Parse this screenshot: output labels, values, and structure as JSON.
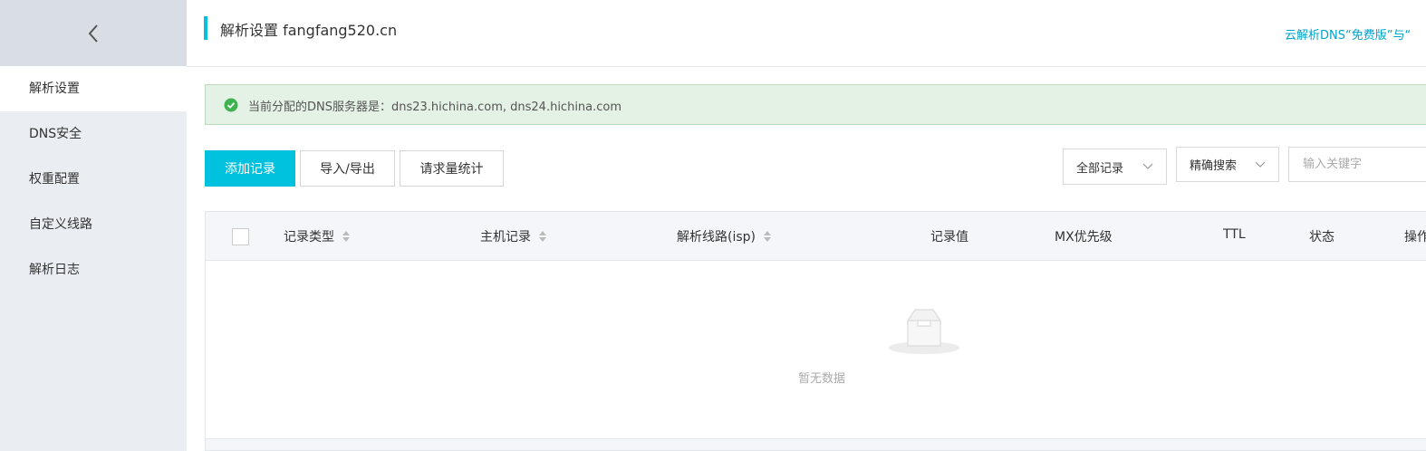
{
  "sidebar": {
    "back_icon": "chevron-left-icon",
    "items": [
      {
        "label": "解析设置",
        "active": true
      },
      {
        "label": "DNS安全",
        "active": false
      },
      {
        "label": "权重配置",
        "active": false
      },
      {
        "label": "自定义线路",
        "active": false
      },
      {
        "label": "解析日志",
        "active": false
      }
    ]
  },
  "header": {
    "title": "解析设置 fangfang520.cn",
    "link_text": "云解析DNS“免费版”与“"
  },
  "notice": {
    "icon": "check-circle-icon",
    "text": "当前分配的DNS服务器是：dns23.hichina.com, dns24.hichina.com"
  },
  "toolbar": {
    "add_label": "添加记录",
    "import_export_label": "导入/导出",
    "stats_label": "请求量统计",
    "filter_select": "全部记录",
    "search_mode_select": "精确搜索",
    "search_placeholder": "输入关键字"
  },
  "table": {
    "columns": [
      {
        "label": "记录类型",
        "sortable": true
      },
      {
        "label": "主机记录",
        "sortable": true
      },
      {
        "label": "解析线路(isp)",
        "sortable": true
      },
      {
        "label": "记录值",
        "sortable": false
      },
      {
        "label": "MX优先级",
        "sortable": false
      },
      {
        "label": "TTL",
        "sortable": false
      },
      {
        "label": "状态",
        "sortable": false
      },
      {
        "label": "操作",
        "sortable": false
      }
    ],
    "empty_icon": "empty-inbox-icon",
    "empty_text": "暂无数据"
  },
  "colors": {
    "accent": "#00c1de",
    "link": "#00a2ca",
    "notice_bg": "#e3f2e4",
    "success": "#3fb34f"
  }
}
